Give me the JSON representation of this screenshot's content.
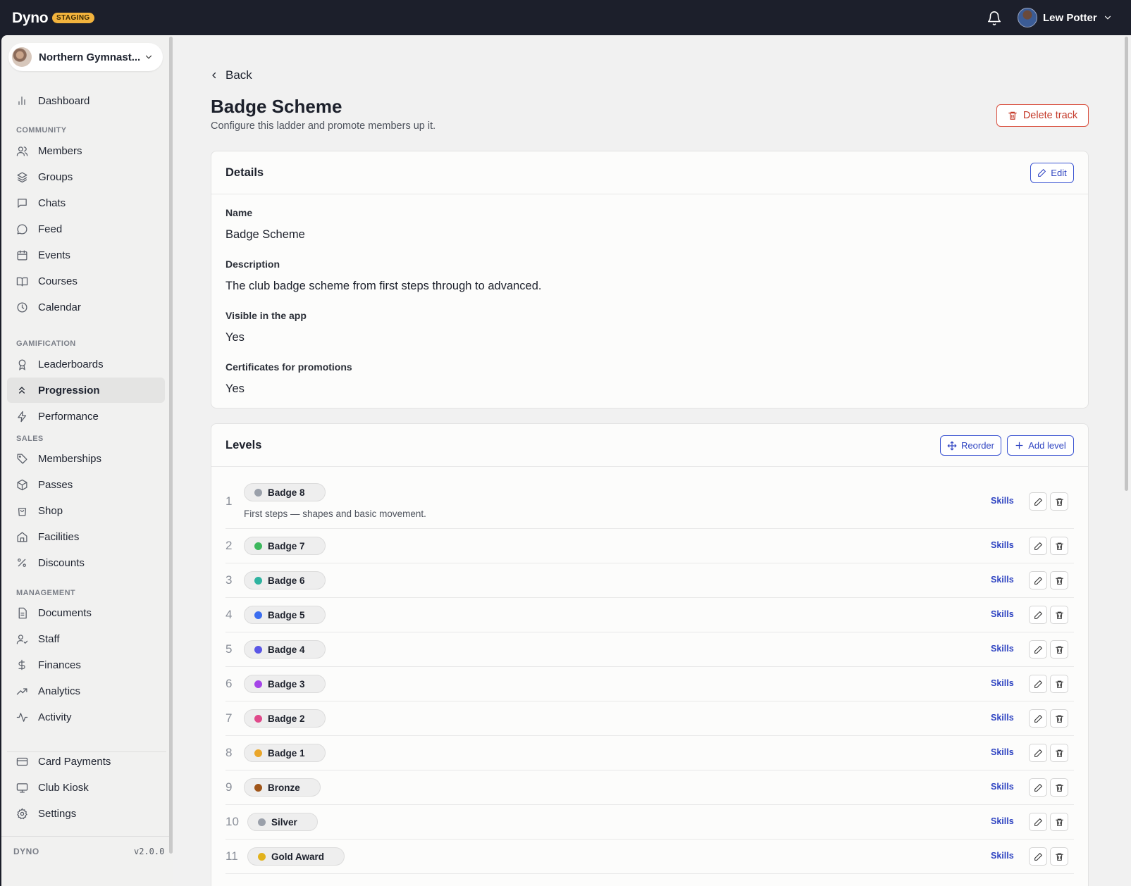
{
  "app": {
    "name": "Dyno",
    "env_badge": "STAGING"
  },
  "user": {
    "name": "Lew Potter"
  },
  "org": {
    "name": "Northern Gymnast..."
  },
  "sidebar": {
    "dashboard": "Dashboard",
    "sections": {
      "community": "COMMUNITY",
      "gamification": "GAMIFICATION",
      "sales": "SALES",
      "management": "MANAGEMENT"
    },
    "items": {
      "members": "Members",
      "groups": "Groups",
      "chats": "Chats",
      "feed": "Feed",
      "events": "Events",
      "courses": "Courses",
      "calendar": "Calendar",
      "leaderboards": "Leaderboards",
      "progression": "Progression",
      "performance": "Performance",
      "memberships": "Memberships",
      "passes": "Passes",
      "shop": "Shop",
      "facilities": "Facilities",
      "discounts": "Discounts",
      "documents": "Documents",
      "staff": "Staff",
      "finances": "Finances",
      "analytics": "Analytics",
      "activity": "Activity",
      "card_payments": "Card Payments",
      "club_kiosk": "Club Kiosk",
      "settings": "Settings"
    },
    "footer": {
      "brand": "DYNO",
      "version": "v2.0.0"
    }
  },
  "page": {
    "back": "Back",
    "title": "Badge Scheme",
    "subtitle": "Configure this ladder and promote members up it.",
    "delete_label": "Delete track"
  },
  "details": {
    "title": "Details",
    "edit_label": "Edit",
    "fields": {
      "name_label": "Name",
      "name_value": "Badge Scheme",
      "description_label": "Description",
      "description_value": "The club badge scheme from first steps through to advanced.",
      "visible_label": "Visible in the app",
      "visible_value": "Yes",
      "certificates_label": "Certificates for promotions",
      "certificates_value": "Yes"
    }
  },
  "levels": {
    "title": "Levels",
    "reorder_label": "Reorder",
    "add_label": "Add level",
    "skills_label": "Skills",
    "rows": [
      {
        "num": "1",
        "name": "Badge 8",
        "color": "#9aa0aa",
        "desc": "First steps — shapes and basic movement."
      },
      {
        "num": "2",
        "name": "Badge 7",
        "color": "#3db85d",
        "desc": ""
      },
      {
        "num": "3",
        "name": "Badge 6",
        "color": "#2fb3a0",
        "desc": ""
      },
      {
        "num": "4",
        "name": "Badge 5",
        "color": "#3b6ef0",
        "desc": ""
      },
      {
        "num": "5",
        "name": "Badge 4",
        "color": "#5b57e6",
        "desc": ""
      },
      {
        "num": "6",
        "name": "Badge 3",
        "color": "#a544e8",
        "desc": ""
      },
      {
        "num": "7",
        "name": "Badge 2",
        "color": "#e04a8b",
        "desc": ""
      },
      {
        "num": "8",
        "name": "Badge 1",
        "color": "#eaa62a",
        "desc": ""
      },
      {
        "num": "9",
        "name": "Bronze",
        "color": "#a0561a",
        "desc": ""
      },
      {
        "num": "10",
        "name": "Silver",
        "color": "#9aa0aa",
        "desc": ""
      },
      {
        "num": "11",
        "name": "Gold Award",
        "color": "#e2b21c",
        "desc": ""
      }
    ]
  }
}
